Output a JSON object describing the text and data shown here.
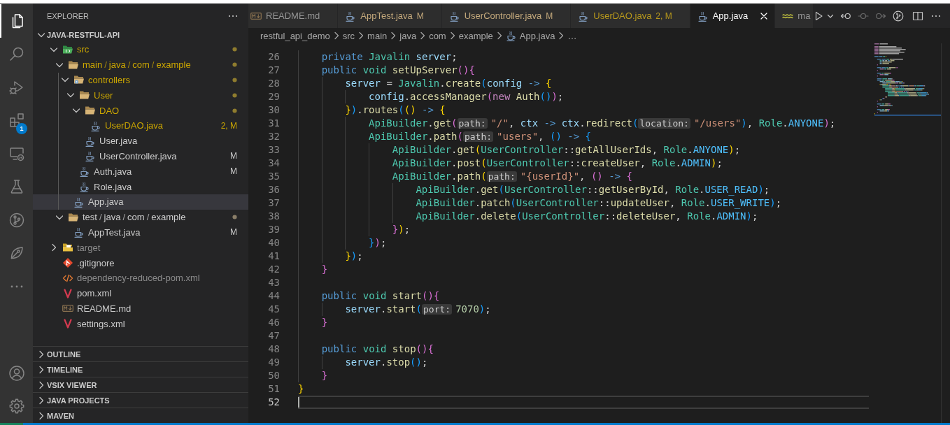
{
  "activity_bar": {
    "items": [
      {
        "kind": "explorer",
        "selected": true
      },
      {
        "kind": "search",
        "selected": false
      },
      {
        "kind": "debug",
        "selected": false
      },
      {
        "kind": "extensions",
        "selected": false,
        "badge": "1"
      },
      {
        "kind": "remote",
        "selected": false
      },
      {
        "kind": "testing",
        "selected": false
      },
      {
        "kind": "scm",
        "selected": false
      },
      {
        "kind": "custom",
        "selected": false
      },
      {
        "kind": "more",
        "selected": false
      }
    ],
    "bottom_items": [
      {
        "kind": "account"
      },
      {
        "kind": "settings"
      }
    ]
  },
  "sidebar": {
    "title": "EXPLORER",
    "root": {
      "label": "JAVA-RESTFUL-API",
      "expanded": true
    },
    "tree": [
      {
        "label": "src",
        "kind": "srcfolder",
        "expanded": true,
        "selected": false,
        "problem": true,
        "ignored": false,
        "dot": true,
        "children": [
          {
            "label": "main/java/com/example",
            "kind": "folder",
            "expanded": true,
            "selected": false,
            "problem": true,
            "ignored": false,
            "dot": true,
            "children": [
              {
                "label": "controllers",
                "kind": "ctlfolder",
                "expanded": true,
                "selected": false,
                "problem": true,
                "ignored": false,
                "dot": true,
                "children": [
                  {
                    "label": "User",
                    "kind": "folder",
                    "expanded": true,
                    "selected": false,
                    "problem": true,
                    "ignored": false,
                    "dot": true,
                    "children": [
                      {
                        "label": "DAO",
                        "kind": "folder",
                        "expanded": true,
                        "selected": false,
                        "problem": true,
                        "ignored": false,
                        "dot": true,
                        "children": [
                          {
                            "label": "UserDAO.java",
                            "kind": "java",
                            "selected": false,
                            "problem": true,
                            "ignored": false,
                            "dot": false,
                            "badge": "2, M"
                          }
                        ]
                      },
                      {
                        "label": "User.java",
                        "kind": "java",
                        "selected": false,
                        "problem": false,
                        "ignored": false,
                        "dot": false
                      },
                      {
                        "label": "UserController.java",
                        "kind": "java",
                        "selected": false,
                        "problem": false,
                        "ignored": false,
                        "dot": false,
                        "badge": "M"
                      }
                    ]
                  },
                  {
                    "label": "Auth.java",
                    "kind": "java",
                    "selected": false,
                    "problem": false,
                    "ignored": false,
                    "dot": false,
                    "badge": "M"
                  },
                  {
                    "label": "Role.java",
                    "kind": "java",
                    "selected": false,
                    "problem": false,
                    "ignored": false,
                    "dot": false
                  }
                ]
              },
              {
                "label": "App.java",
                "kind": "java",
                "selected": true,
                "problem": false,
                "ignored": false,
                "dot": false
              }
            ]
          },
          {
            "label": "test/java/com/example",
            "kind": "folder",
            "expanded": true,
            "selected": false,
            "problem": false,
            "ignored": false,
            "dot": true,
            "children": [
              {
                "label": "AppTest.java",
                "kind": "java",
                "selected": false,
                "problem": false,
                "ignored": false,
                "dot": false,
                "badge": "M"
              }
            ]
          }
        ]
      },
      {
        "label": "target",
        "kind": "buildfolder",
        "expanded": false,
        "selected": false,
        "problem": false,
        "ignored": true,
        "dot": false
      },
      {
        "label": ".gitignore",
        "kind": "git",
        "selected": false,
        "problem": false,
        "ignored": false,
        "dot": false
      },
      {
        "label": "dependency-reduced-pom.xml",
        "kind": "xml",
        "selected": false,
        "problem": false,
        "ignored": true,
        "dot": false
      },
      {
        "label": "pom.xml",
        "kind": "maven",
        "selected": false,
        "problem": false,
        "ignored": false,
        "dot": false
      },
      {
        "label": "README.md",
        "kind": "markdown",
        "selected": false,
        "problem": false,
        "ignored": false,
        "dot": false
      },
      {
        "label": "settings.xml",
        "kind": "maven",
        "selected": false,
        "problem": false,
        "ignored": false,
        "dot": false
      }
    ],
    "sections": [
      {
        "label": "OUTLINE",
        "expanded": false
      },
      {
        "label": "TIMELINE",
        "expanded": false
      },
      {
        "label": "VSIX VIEWER",
        "expanded": false
      },
      {
        "label": "JAVA PROJECTS",
        "expanded": false
      },
      {
        "label": "MAVEN",
        "expanded": false
      }
    ]
  },
  "editor": {
    "tabs": [
      {
        "label": "README.md",
        "kind": "markdown",
        "modified": false,
        "problem": false,
        "selected": false
      },
      {
        "label": "AppTest.java",
        "kind": "java",
        "modified": true,
        "problem": false,
        "badge": "M",
        "selected": false
      },
      {
        "label": "UserController.java",
        "kind": "java",
        "modified": true,
        "problem": false,
        "badge": "M",
        "selected": false
      },
      {
        "label": "UserDAO.java",
        "kind": "java",
        "modified": true,
        "problem": true,
        "badge": "2, M",
        "selected": false
      },
      {
        "label": "App.java",
        "kind": "java",
        "modified": false,
        "problem": false,
        "selected": true
      },
      {
        "label": "ma",
        "kind": "config",
        "modified": false,
        "problem": false,
        "selected": false
      }
    ],
    "actions": [
      {
        "kind": "run",
        "disabled": false
      },
      {
        "kind": "dropdown",
        "disabled": false
      },
      {
        "kind": "previous",
        "disabled": false
      },
      {
        "kind": "commit",
        "disabled": true
      },
      {
        "kind": "next",
        "disabled": true
      },
      {
        "kind": "graph",
        "disabled": false
      },
      {
        "kind": "split",
        "disabled": false
      },
      {
        "kind": "more",
        "disabled": false
      }
    ],
    "breadcrumbs": [
      {
        "label": "restful_api_demo"
      },
      {
        "label": "src"
      },
      {
        "label": "main"
      },
      {
        "label": "java"
      },
      {
        "label": "com"
      },
      {
        "label": "example"
      },
      {
        "label": "App.java",
        "kind": "java"
      },
      {
        "label": "…"
      }
    ],
    "lines": [
      {
        "number": "26",
        "current": false,
        "tokens": [
          {
            "text": "    private ",
            "kind": "keyword"
          },
          {
            "text": "Javalin ",
            "kind": "type"
          },
          {
            "text": "server",
            "kind": "variable"
          },
          {
            "text": ";",
            "kind": "plain"
          }
        ]
      },
      {
        "number": "27",
        "current": false,
        "tokens": [
          {
            "text": "    public ",
            "kind": "keyword"
          },
          {
            "text": "void ",
            "kind": "type"
          },
          {
            "text": "setUpServer",
            "kind": "function"
          },
          {
            "text": "(){",
            "kind": "bracket2"
          }
        ]
      },
      {
        "number": "28",
        "current": false,
        "tokens": [
          {
            "text": "        server",
            "kind": "variable"
          },
          {
            "text": " = ",
            "kind": "plain"
          },
          {
            "text": "Javalin",
            "kind": "type"
          },
          {
            "text": ".",
            "kind": "plain"
          },
          {
            "text": "create",
            "kind": "function"
          },
          {
            "text": "(",
            "kind": "bracket3"
          },
          {
            "text": "config ",
            "kind": "variable"
          },
          {
            "text": "-> ",
            "kind": "arrow"
          },
          {
            "text": "{",
            "kind": "bracket1"
          }
        ]
      },
      {
        "number": "29",
        "current": false,
        "tokens": [
          {
            "text": "            config",
            "kind": "variable"
          },
          {
            "text": ".",
            "kind": "plain"
          },
          {
            "text": "accessManager",
            "kind": "function"
          },
          {
            "text": "(",
            "kind": "bracket2"
          },
          {
            "text": "new ",
            "kind": "new"
          },
          {
            "text": "Auth",
            "kind": "function"
          },
          {
            "text": "()",
            "kind": "bracket3"
          },
          {
            "text": ")",
            "kind": "bracket2"
          },
          {
            "text": ";",
            "kind": "plain"
          }
        ]
      },
      {
        "number": "30",
        "current": false,
        "tokens": [
          {
            "text": "        }",
            "kind": "bracket1"
          },
          {
            "text": ")",
            "kind": "bracket3"
          },
          {
            "text": ".",
            "kind": "plain"
          },
          {
            "text": "routes",
            "kind": "function"
          },
          {
            "text": "(",
            "kind": "bracket3"
          },
          {
            "text": "()",
            "kind": "bracket1"
          },
          {
            "text": " -> ",
            "kind": "arrow"
          },
          {
            "text": "{",
            "kind": "bracket1"
          }
        ]
      },
      {
        "number": "31",
        "current": false,
        "tokens": [
          {
            "text": "            ApiBuilder",
            "kind": "type"
          },
          {
            "text": ".",
            "kind": "plain"
          },
          {
            "text": "get",
            "kind": "function"
          },
          {
            "text": "(",
            "kind": "bracket2"
          },
          {
            "text": "path:",
            "kind": "hint"
          },
          {
            "text": "\"/\"",
            "kind": "string"
          },
          {
            "text": ", ",
            "kind": "plain"
          },
          {
            "text": "ctx ",
            "kind": "variable"
          },
          {
            "text": "-> ",
            "kind": "arrow"
          },
          {
            "text": "ctx",
            "kind": "variable"
          },
          {
            "text": ".",
            "kind": "plain"
          },
          {
            "text": "redirect",
            "kind": "function"
          },
          {
            "text": "(",
            "kind": "bracket3"
          },
          {
            "text": "location:",
            "kind": "hint"
          },
          {
            "text": "\"/users\"",
            "kind": "string"
          },
          {
            "text": ")",
            "kind": "bracket3"
          },
          {
            "text": ", ",
            "kind": "plain"
          },
          {
            "text": "Role",
            "kind": "type"
          },
          {
            "text": ".",
            "kind": "plain"
          },
          {
            "text": "ANYONE",
            "kind": "constant"
          },
          {
            "text": ")",
            "kind": "bracket2"
          },
          {
            "text": ";",
            "kind": "plain"
          }
        ]
      },
      {
        "number": "32",
        "current": false,
        "tokens": [
          {
            "text": "            ApiBuilder",
            "kind": "type"
          },
          {
            "text": ".",
            "kind": "plain"
          },
          {
            "text": "path",
            "kind": "function"
          },
          {
            "text": "(",
            "kind": "bracket2"
          },
          {
            "text": "path:",
            "kind": "hint"
          },
          {
            "text": "\"users\"",
            "kind": "string"
          },
          {
            "text": ", ",
            "kind": "plain"
          },
          {
            "text": "()",
            "kind": "bracket3"
          },
          {
            "text": " -> ",
            "kind": "arrow"
          },
          {
            "text": "{",
            "kind": "bracket3"
          }
        ]
      },
      {
        "number": "33",
        "current": false,
        "tokens": [
          {
            "text": "                ApiBuilder",
            "kind": "type"
          },
          {
            "text": ".",
            "kind": "plain"
          },
          {
            "text": "get",
            "kind": "function"
          },
          {
            "text": "(",
            "kind": "bracket1"
          },
          {
            "text": "UserController",
            "kind": "type"
          },
          {
            "text": "::",
            "kind": "plain"
          },
          {
            "text": "getAllUserIds",
            "kind": "function"
          },
          {
            "text": ", ",
            "kind": "plain"
          },
          {
            "text": "Role",
            "kind": "type"
          },
          {
            "text": ".",
            "kind": "plain"
          },
          {
            "text": "ANYONE",
            "kind": "constant"
          },
          {
            "text": ")",
            "kind": "bracket1"
          },
          {
            "text": ";",
            "kind": "plain"
          }
        ]
      },
      {
        "number": "34",
        "current": false,
        "tokens": [
          {
            "text": "                ApiBuilder",
            "kind": "type"
          },
          {
            "text": ".",
            "kind": "plain"
          },
          {
            "text": "post",
            "kind": "function"
          },
          {
            "text": "(",
            "kind": "bracket1"
          },
          {
            "text": "UserController",
            "kind": "type"
          },
          {
            "text": "::",
            "kind": "plain"
          },
          {
            "text": "createUser",
            "kind": "function"
          },
          {
            "text": ", ",
            "kind": "plain"
          },
          {
            "text": "Role",
            "kind": "type"
          },
          {
            "text": ".",
            "kind": "plain"
          },
          {
            "text": "ADMIN",
            "kind": "constant"
          },
          {
            "text": ")",
            "kind": "bracket1"
          },
          {
            "text": ";",
            "kind": "plain"
          }
        ]
      },
      {
        "number": "35",
        "current": false,
        "tokens": [
          {
            "text": "                ApiBuilder",
            "kind": "type"
          },
          {
            "text": ".",
            "kind": "plain"
          },
          {
            "text": "path",
            "kind": "function"
          },
          {
            "text": "(",
            "kind": "bracket1"
          },
          {
            "text": "path:",
            "kind": "hint"
          },
          {
            "text": "\"{userId}\"",
            "kind": "string"
          },
          {
            "text": ", ",
            "kind": "plain"
          },
          {
            "text": "()",
            "kind": "bracket2"
          },
          {
            "text": " -> ",
            "kind": "arrow"
          },
          {
            "text": "{",
            "kind": "bracket2"
          }
        ]
      },
      {
        "number": "36",
        "current": false,
        "tokens": [
          {
            "text": "                    ApiBuilder",
            "kind": "type"
          },
          {
            "text": ".",
            "kind": "plain"
          },
          {
            "text": "get",
            "kind": "function"
          },
          {
            "text": "(",
            "kind": "bracket3"
          },
          {
            "text": "UserController",
            "kind": "type"
          },
          {
            "text": "::",
            "kind": "plain"
          },
          {
            "text": "getUserById",
            "kind": "function"
          },
          {
            "text": ", ",
            "kind": "plain"
          },
          {
            "text": "Role",
            "kind": "type"
          },
          {
            "text": ".",
            "kind": "plain"
          },
          {
            "text": "USER_READ",
            "kind": "constant"
          },
          {
            "text": ")",
            "kind": "bracket3"
          },
          {
            "text": ";",
            "kind": "plain"
          }
        ]
      },
      {
        "number": "37",
        "current": false,
        "tokens": [
          {
            "text": "                    ApiBuilder",
            "kind": "type"
          },
          {
            "text": ".",
            "kind": "plain"
          },
          {
            "text": "patch",
            "kind": "function"
          },
          {
            "text": "(",
            "kind": "bracket3"
          },
          {
            "text": "UserController",
            "kind": "type"
          },
          {
            "text": "::",
            "kind": "plain"
          },
          {
            "text": "updateUser",
            "kind": "function"
          },
          {
            "text": ", ",
            "kind": "plain"
          },
          {
            "text": "Role",
            "kind": "type"
          },
          {
            "text": ".",
            "kind": "plain"
          },
          {
            "text": "USER_WRITE",
            "kind": "constant"
          },
          {
            "text": ")",
            "kind": "bracket3"
          },
          {
            "text": ";",
            "kind": "plain"
          }
        ]
      },
      {
        "number": "38",
        "current": false,
        "tokens": [
          {
            "text": "                    ApiBuilder",
            "kind": "type"
          },
          {
            "text": ".",
            "kind": "plain"
          },
          {
            "text": "delete",
            "kind": "function"
          },
          {
            "text": "(",
            "kind": "bracket3"
          },
          {
            "text": "UserController",
            "kind": "type"
          },
          {
            "text": "::",
            "kind": "plain"
          },
          {
            "text": "deleteUser",
            "kind": "function"
          },
          {
            "text": ", ",
            "kind": "plain"
          },
          {
            "text": "Role",
            "kind": "type"
          },
          {
            "text": ".",
            "kind": "plain"
          },
          {
            "text": "ADMIN",
            "kind": "constant"
          },
          {
            "text": ")",
            "kind": "bracket3"
          },
          {
            "text": ";",
            "kind": "plain"
          }
        ]
      },
      {
        "number": "39",
        "current": false,
        "tokens": [
          {
            "text": "                }",
            "kind": "bracket2"
          },
          {
            "text": ")",
            "kind": "bracket1"
          },
          {
            "text": ";",
            "kind": "plain"
          }
        ]
      },
      {
        "number": "40",
        "current": false,
        "tokens": [
          {
            "text": "            }",
            "kind": "bracket3"
          },
          {
            "text": ")",
            "kind": "bracket2"
          },
          {
            "text": ";",
            "kind": "plain"
          }
        ]
      },
      {
        "number": "41",
        "current": false,
        "tokens": [
          {
            "text": "        }",
            "kind": "bracket1"
          },
          {
            "text": ")",
            "kind": "bracket3"
          },
          {
            "text": ";",
            "kind": "plain"
          }
        ]
      },
      {
        "number": "42",
        "current": false,
        "tokens": [
          {
            "text": "    }",
            "kind": "bracket2"
          }
        ]
      },
      {
        "number": "43",
        "current": false
      },
      {
        "number": "44",
        "current": false,
        "tokens": [
          {
            "text": "    public ",
            "kind": "keyword"
          },
          {
            "text": "void ",
            "kind": "type"
          },
          {
            "text": "start",
            "kind": "function"
          },
          {
            "text": "(){",
            "kind": "bracket2"
          }
        ]
      },
      {
        "number": "45",
        "current": false,
        "tokens": [
          {
            "text": "        server",
            "kind": "variable"
          },
          {
            "text": ".",
            "kind": "plain"
          },
          {
            "text": "start",
            "kind": "function"
          },
          {
            "text": "(",
            "kind": "bracket3"
          },
          {
            "text": "port:",
            "kind": "hint"
          },
          {
            "text": "7070",
            "kind": "number"
          },
          {
            "text": ")",
            "kind": "bracket3"
          },
          {
            "text": ";",
            "kind": "plain"
          }
        ]
      },
      {
        "number": "46",
        "current": false,
        "tokens": [
          {
            "text": "    }",
            "kind": "bracket2"
          }
        ]
      },
      {
        "number": "47",
        "current": false
      },
      {
        "number": "48",
        "current": false,
        "tokens": [
          {
            "text": "    public ",
            "kind": "keyword"
          },
          {
            "text": "void ",
            "kind": "type"
          },
          {
            "text": "stop",
            "kind": "function"
          },
          {
            "text": "(){",
            "kind": "bracket2"
          }
        ]
      },
      {
        "number": "49",
        "current": false,
        "tokens": [
          {
            "text": "        server",
            "kind": "variable"
          },
          {
            "text": ".",
            "kind": "plain"
          },
          {
            "text": "stop",
            "kind": "function"
          },
          {
            "text": "()",
            "kind": "bracket3"
          },
          {
            "text": ";",
            "kind": "plain"
          }
        ]
      },
      {
        "number": "50",
        "current": false,
        "tokens": [
          {
            "text": "    }",
            "kind": "bracket2"
          }
        ]
      },
      {
        "number": "51",
        "current": false,
        "tokens": [
          {
            "text": "}",
            "kind": "bracket1"
          }
        ]
      },
      {
        "number": "52",
        "current": true
      }
    ]
  }
}
